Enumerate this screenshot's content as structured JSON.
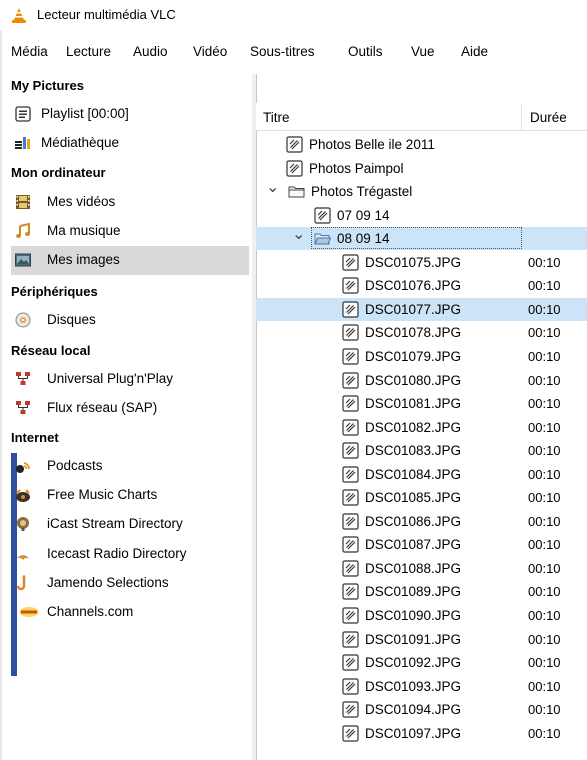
{
  "window": {
    "title": "Lecteur multimédia VLC"
  },
  "menu": [
    "Média",
    "Lecture",
    "Audio",
    "Vidéo",
    "Sous-titres",
    "Outils",
    "Vue",
    "Aide"
  ],
  "sidebar": {
    "sections": [
      {
        "title": "My Pictures",
        "items": [
          {
            "label": "Playlist [00:00]",
            "icon": "playlist-icon"
          },
          {
            "label": "Médiathèque",
            "icon": "library-icon"
          }
        ]
      },
      {
        "title": "Mon ordinateur",
        "items": [
          {
            "label": "Mes vidéos",
            "icon": "film-icon"
          },
          {
            "label": "Ma musique",
            "icon": "music-note-icon"
          },
          {
            "label": "Mes images",
            "icon": "image-icon",
            "selected": true
          }
        ]
      },
      {
        "title": "Périphériques",
        "items": [
          {
            "label": "Disques",
            "icon": "disc-icon"
          }
        ]
      },
      {
        "title": "Réseau local",
        "items": [
          {
            "label": "Universal Plug'n'Play",
            "icon": "network-icon"
          },
          {
            "label": "Flux réseau (SAP)",
            "icon": "network-icon"
          }
        ]
      },
      {
        "title": "Internet",
        "items": [
          {
            "label": "Podcasts",
            "icon": "podcast-icon"
          },
          {
            "label": "Free Music Charts",
            "icon": "charts-icon"
          },
          {
            "label": "iCast Stream Directory",
            "icon": "icast-icon"
          },
          {
            "label": "Icecast Radio Directory",
            "icon": "icecast-icon"
          },
          {
            "label": "Jamendo Selections",
            "icon": "jamendo-icon"
          },
          {
            "label": "Channels.com",
            "icon": "channels-icon"
          }
        ]
      }
    ]
  },
  "playlist": {
    "columns": {
      "title": "Titre",
      "duration": "Durée"
    },
    "rows": [
      {
        "label": "Photos Belle ile 2011",
        "icon": "media-file-icon",
        "level": 1
      },
      {
        "label": "Photos Paimpol",
        "icon": "media-file-icon",
        "level": 1
      },
      {
        "label": "Photos Trégastel",
        "icon": "folder-icon",
        "level": 0,
        "expanded": true
      },
      {
        "label": "07 09 14",
        "icon": "media-file-icon",
        "level": 2
      },
      {
        "label": "08 09 14",
        "icon": "folder-open-icon",
        "level": 1,
        "expanded": true,
        "selected": true,
        "focused": true
      },
      {
        "label": "DSC01075.JPG",
        "duration": "00:10",
        "icon": "media-file-icon",
        "level": 3
      },
      {
        "label": "DSC01076.JPG",
        "duration": "00:10",
        "icon": "media-file-icon",
        "level": 3
      },
      {
        "label": "DSC01077.JPG",
        "duration": "00:10",
        "icon": "media-file-icon",
        "level": 3,
        "selected": true
      },
      {
        "label": "DSC01078.JPG",
        "duration": "00:10",
        "icon": "media-file-icon",
        "level": 3
      },
      {
        "label": "DSC01079.JPG",
        "duration": "00:10",
        "icon": "media-file-icon",
        "level": 3
      },
      {
        "label": "DSC01080.JPG",
        "duration": "00:10",
        "icon": "media-file-icon",
        "level": 3
      },
      {
        "label": "DSC01081.JPG",
        "duration": "00:10",
        "icon": "media-file-icon",
        "level": 3
      },
      {
        "label": "DSC01082.JPG",
        "duration": "00:10",
        "icon": "media-file-icon",
        "level": 3
      },
      {
        "label": "DSC01083.JPG",
        "duration": "00:10",
        "icon": "media-file-icon",
        "level": 3
      },
      {
        "label": "DSC01084.JPG",
        "duration": "00:10",
        "icon": "media-file-icon",
        "level": 3
      },
      {
        "label": "DSC01085.JPG",
        "duration": "00:10",
        "icon": "media-file-icon",
        "level": 3
      },
      {
        "label": "DSC01086.JPG",
        "duration": "00:10",
        "icon": "media-file-icon",
        "level": 3
      },
      {
        "label": "DSC01087.JPG",
        "duration": "00:10",
        "icon": "media-file-icon",
        "level": 3
      },
      {
        "label": "DSC01088.JPG",
        "duration": "00:10",
        "icon": "media-file-icon",
        "level": 3
      },
      {
        "label": "DSC01089.JPG",
        "duration": "00:10",
        "icon": "media-file-icon",
        "level": 3
      },
      {
        "label": "DSC01090.JPG",
        "duration": "00:10",
        "icon": "media-file-icon",
        "level": 3
      },
      {
        "label": "DSC01091.JPG",
        "duration": "00:10",
        "icon": "media-file-icon",
        "level": 3
      },
      {
        "label": "DSC01092.JPG",
        "duration": "00:10",
        "icon": "media-file-icon",
        "level": 3
      },
      {
        "label": "DSC01093.JPG",
        "duration": "00:10",
        "icon": "media-file-icon",
        "level": 3
      },
      {
        "label": "DSC01094.JPG",
        "duration": "00:10",
        "icon": "media-file-icon",
        "level": 3
      },
      {
        "label": "DSC01097.JPG",
        "duration": "00:10",
        "icon": "media-file-icon",
        "level": 3
      }
    ]
  },
  "colors": {
    "selection": "#cce4f7",
    "sidebar_selection": "#d9d9d9",
    "internet_bar": "#2f4f9f",
    "vlc_orange": "#f08a00"
  }
}
